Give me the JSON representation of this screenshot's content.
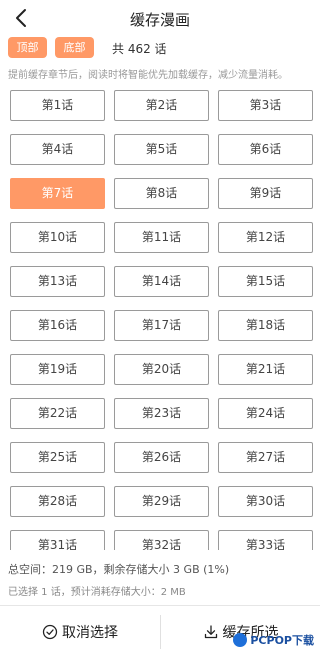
{
  "header": {
    "title": "缓存漫画",
    "back_icon": "back-arrow-icon"
  },
  "controls": {
    "top_label": "顶部",
    "bottom_label": "底部",
    "count_text": "共 462 话",
    "accent": "#ff9966"
  },
  "hint": "提前缓存章节后，阅读时将智能优先加载缓存，减少流量消耗。",
  "chapters": [
    {
      "label": "第1话"
    },
    {
      "label": "第2话"
    },
    {
      "label": "第3话"
    },
    {
      "label": "第4话"
    },
    {
      "label": "第5话"
    },
    {
      "label": "第6话"
    },
    {
      "label": "第7话"
    },
    {
      "label": "第8话"
    },
    {
      "label": "第9话"
    },
    {
      "label": "第10话"
    },
    {
      "label": "第11话"
    },
    {
      "label": "第12话"
    },
    {
      "label": "第13话"
    },
    {
      "label": "第14话"
    },
    {
      "label": "第15话"
    },
    {
      "label": "第16话"
    },
    {
      "label": "第17话"
    },
    {
      "label": "第18话"
    },
    {
      "label": "第19话"
    },
    {
      "label": "第20话"
    },
    {
      "label": "第21话"
    },
    {
      "label": "第22话"
    },
    {
      "label": "第23话"
    },
    {
      "label": "第24话"
    },
    {
      "label": "第25话"
    },
    {
      "label": "第26话"
    },
    {
      "label": "第27话"
    },
    {
      "label": "第28话"
    },
    {
      "label": "第29话"
    },
    {
      "label": "第30话"
    },
    {
      "label": "第31话"
    },
    {
      "label": "第32话"
    },
    {
      "label": "第33话"
    }
  ],
  "selected_chapter": "第7话",
  "storage": "总空间：219 GB，剩余存储大小 3 GB (1%)",
  "selection_info": "已选择 1 话，预计消耗存储大小：2 MB",
  "bottom": {
    "cancel_label": "取消选择",
    "save_label": "缓存所选"
  },
  "watermark": {
    "text": "PCPOP下载"
  }
}
